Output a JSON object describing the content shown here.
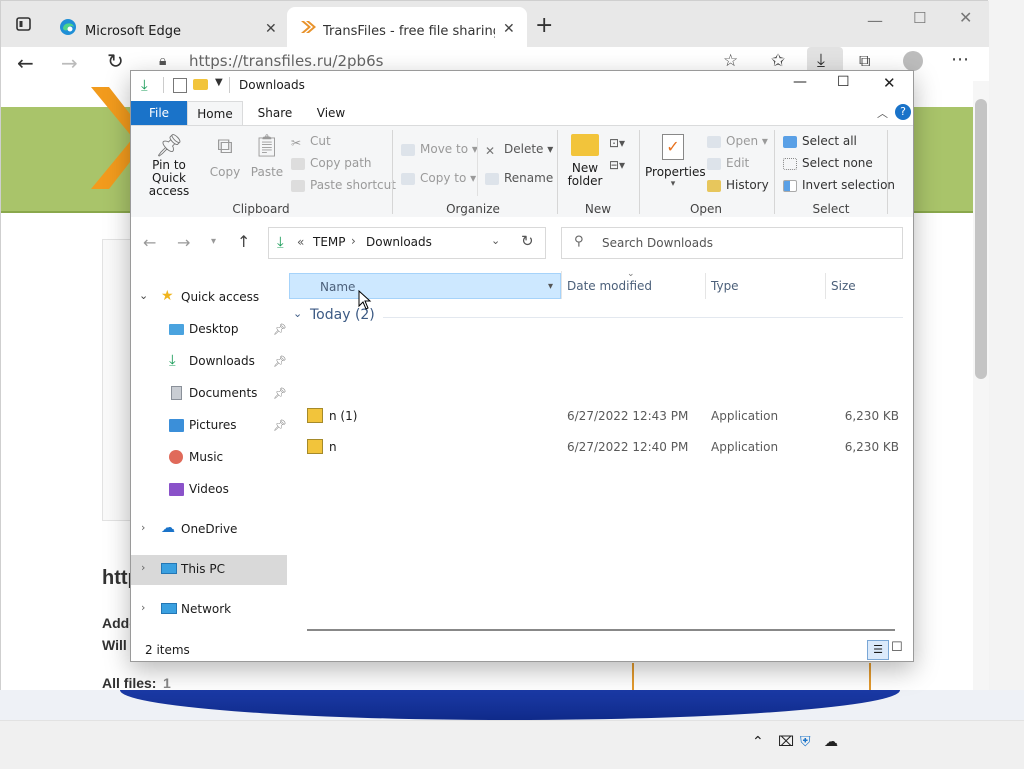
{
  "browser": {
    "tabs": [
      {
        "label": "Microsoft Edge",
        "icon": "edge-icon"
      },
      {
        "label": "TransFiles - free file sharing serv",
        "icon": "transfiles-icon"
      }
    ],
    "url": "https://transfiles.ru/2pb6s",
    "page": {
      "heading_partial": "http",
      "line1_partial": "Adde",
      "line2_partial": "Will",
      "all_files_label": "All files:",
      "all_files_count": "1"
    },
    "accent": "#a9c46a"
  },
  "explorer": {
    "title": "Downloads",
    "ribbon_tabs": [
      "File",
      "Home",
      "Share",
      "View"
    ],
    "clipboard": {
      "pin": "Pin to Quick access",
      "copy": "Copy",
      "paste": "Paste",
      "cut": "Cut",
      "copy_path": "Copy path",
      "paste_shortcut": "Paste shortcut",
      "group": "Clipboard"
    },
    "organize": {
      "move_to": "Move to",
      "copy_to": "Copy to",
      "delete": "Delete",
      "rename": "Rename",
      "group": "Organize"
    },
    "new": {
      "new_folder": "New folder",
      "group": "New"
    },
    "open": {
      "properties": "Properties",
      "open": "Open",
      "edit": "Edit",
      "history": "History",
      "group": "Open"
    },
    "select": {
      "select_all": "Select all",
      "select_none": "Select none",
      "invert": "Invert selection",
      "group": "Select"
    },
    "path": {
      "prefix": "«",
      "segments": [
        "TEMP",
        "Downloads"
      ]
    },
    "search_placeholder": "Search Downloads",
    "nav": {
      "quick_access": "Quick access",
      "items": [
        {
          "label": "Desktop",
          "pinned": true
        },
        {
          "label": "Downloads",
          "pinned": true
        },
        {
          "label": "Documents",
          "pinned": true
        },
        {
          "label": "Pictures",
          "pinned": true
        },
        {
          "label": "Music",
          "pinned": false
        },
        {
          "label": "Videos",
          "pinned": false
        }
      ],
      "onedrive": "OneDrive",
      "this_pc": "This PC",
      "network": "Network"
    },
    "columns": [
      "Name",
      "Date modified",
      "Type",
      "Size"
    ],
    "group_header": "Today (2)",
    "files": [
      {
        "name": "n (1)",
        "date": "6/27/2022 12:43 PM",
        "type": "Application",
        "size": "6,230 KB"
      },
      {
        "name": "n",
        "date": "6/27/2022 12:40 PM",
        "type": "Application",
        "size": "6,230 KB"
      }
    ],
    "status": "2 items"
  }
}
